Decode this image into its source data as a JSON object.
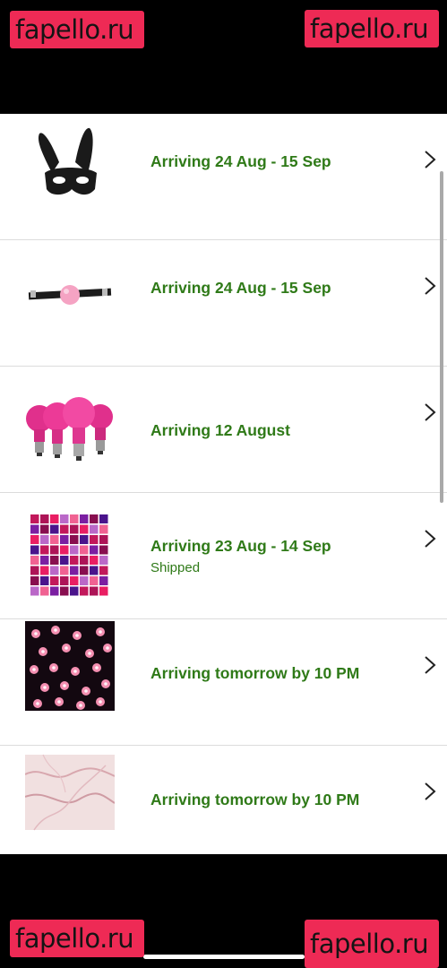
{
  "watermark": {
    "text": "fapello.ru",
    "color": "#ee2a55"
  },
  "orders": [
    {
      "product_icon": "bunny-mask-icon",
      "arrival": "Arriving 24 Aug - 15 Sep",
      "status": ""
    },
    {
      "product_icon": "ball-gag-icon",
      "arrival": "Arriving 24 Aug - 15 Sep",
      "status": ""
    },
    {
      "product_icon": "pink-bulbs-icon",
      "arrival": "Arriving 12 August",
      "status": ""
    },
    {
      "product_icon": "photo-collage-icon",
      "arrival": "Arriving 23 Aug - 14 Sep",
      "status": "Shipped"
    },
    {
      "product_icon": "flower-lights-icon",
      "arrival": "Arriving tomorrow by 10 PM",
      "status": ""
    },
    {
      "product_icon": "marble-tapestry-icon",
      "arrival": "Arriving tomorrow by 10 PM",
      "status": ""
    }
  ],
  "colors": {
    "arrival_text": "#2f7a18",
    "background": "#ffffff",
    "frame": "#000000"
  }
}
